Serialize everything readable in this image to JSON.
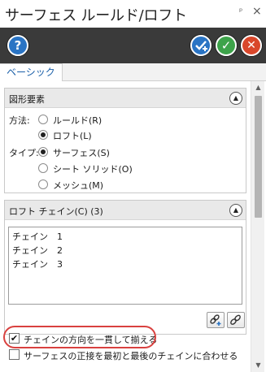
{
  "window": {
    "title": "サーフェス ルールド/ロフト",
    "pin_glyph": "ᵖ",
    "close_glyph": "×"
  },
  "toolbar": {
    "help_glyph": "?",
    "ok_glyph": "✓",
    "cancel_glyph": "✕"
  },
  "tabs": [
    {
      "label": "ベーシック",
      "selected": true
    }
  ],
  "shape_group": {
    "title": "図形要素",
    "method_label": "方法:",
    "method_options": [
      {
        "label": "ルールド(R)",
        "selected": false
      },
      {
        "label": "ロフト(L)",
        "selected": true
      }
    ],
    "type_label": "タイプ:",
    "type_options": [
      {
        "label": "サーフェス(S)",
        "selected": true
      },
      {
        "label": "シート ソリッド(O)",
        "selected": false
      },
      {
        "label": "メッシュ(M)",
        "selected": false
      }
    ]
  },
  "chain_group": {
    "title": "ロフト チェイン(C) (3)",
    "chains": [
      "チェイン　1",
      "チェイン　2",
      "チェイン　3"
    ]
  },
  "options": {
    "align_direction": {
      "label": "チェインの方向を一貫して揃える",
      "checked": true
    },
    "tangent_match": {
      "label": "サーフェスの正接を最初と最後のチェインに合わせる",
      "checked": false
    }
  },
  "colors": {
    "toolbar_bg": "#3a3a3a",
    "help": "#2a74c4",
    "ok": "#3da34a",
    "cancel": "#d9472b",
    "tab_text": "#1a5fa8",
    "annotation": "#d9413f"
  }
}
